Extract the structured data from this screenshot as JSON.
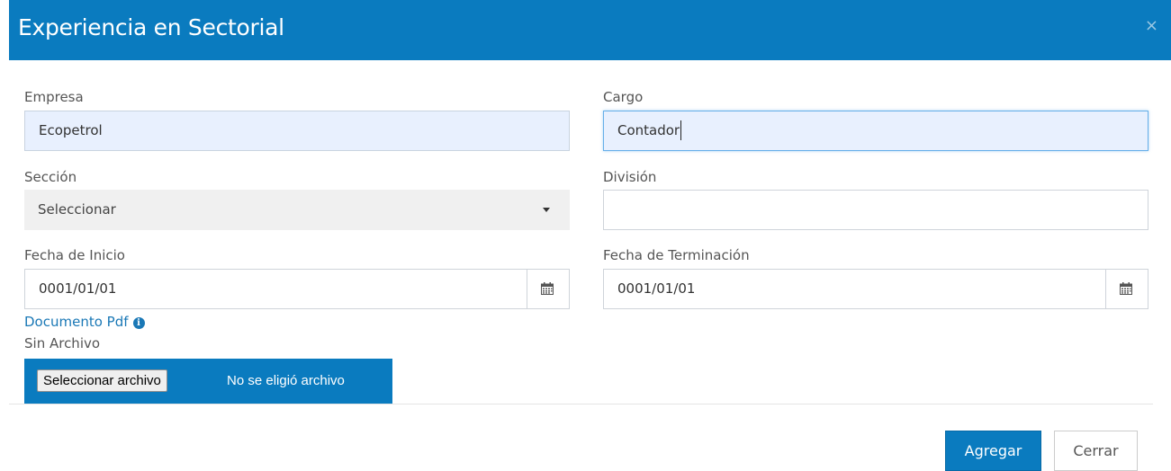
{
  "modal": {
    "title": "Experiencia en Sectorial",
    "close_glyph": "×"
  },
  "form": {
    "empresa": {
      "label": "Empresa",
      "value": "Ecopetrol"
    },
    "cargo": {
      "label": "Cargo",
      "value": "Contador"
    },
    "seccion": {
      "label": "Sección",
      "selected": "Seleccionar"
    },
    "division": {
      "label": "División",
      "value": ""
    },
    "fecha_inicio": {
      "label": "Fecha de Inicio",
      "value": "0001/01/01",
      "icon": "calendar-icon"
    },
    "fecha_terminacion": {
      "label": "Fecha de Terminación",
      "value": "0001/01/01",
      "icon": "calendar-icon"
    },
    "documento": {
      "link_label": "Documento Pdf",
      "info_glyph": "i",
      "status": "Sin Archivo",
      "file_button": "Seleccionar archivo",
      "file_status": "No se eligió archivo"
    }
  },
  "footer": {
    "primary_label": "Agregar",
    "secondary_label": "Cerrar"
  },
  "colors": {
    "header": "#0a7bbf",
    "primary": "#0a7bbf",
    "link": "#1a78b6",
    "autofill": "#e8f0fe"
  }
}
